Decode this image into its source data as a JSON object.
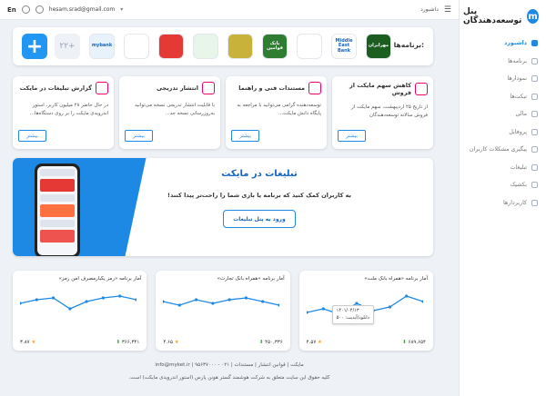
{
  "brand": {
    "title": "پنل توسعه‌دهندگان",
    "logo": "m"
  },
  "topbar": {
    "lang": "En",
    "email": "hesam.srad@gmail.com",
    "breadcrumb": "داشبورد"
  },
  "sidebar": {
    "items": [
      {
        "label": "داشبورد",
        "active": true
      },
      {
        "label": "برنامه‌ها"
      },
      {
        "label": "نمودارها"
      },
      {
        "label": "تیکت‌ها"
      },
      {
        "label": "مالی"
      },
      {
        "label": "پروفایل"
      },
      {
        "label": "پیگیری مشکلات کاربران"
      },
      {
        "label": "تبلیغات"
      },
      {
        "label": "بکشیک"
      },
      {
        "label": "کاربردارها"
      }
    ]
  },
  "apps": {
    "label": "برنامه‌ها:",
    "more": "۲۲+",
    "list": [
      {
        "text": "mybank",
        "color": "#e8f2fb"
      },
      {
        "text": "",
        "color": "#ffffff"
      },
      {
        "text": "",
        "color": "#e53935"
      },
      {
        "text": "",
        "color": "#e8f5e9"
      },
      {
        "text": "",
        "color": "#c8b23a"
      },
      {
        "text": "بانک قوامین",
        "color": "#2e7d32"
      },
      {
        "text": "",
        "color": "#ffffff"
      },
      {
        "text": "Middle East Bank",
        "color": "#ffffff"
      },
      {
        "text": "مهرایران",
        "color": "#1b5e20"
      }
    ]
  },
  "features": [
    {
      "title": "کاهش سهم مایکت از فروش",
      "desc": "از تاریخ ۲۵ اردیبهشت، سهم مایکت از فروش سالانه توسعه‌دهندگان",
      "btn": "بیشتر"
    },
    {
      "title": "مستندات فنی و راهنما",
      "desc": "توسعه‌دهنده گرامی می‌توانید با مراجعه به پایگاه دانش مایکت...",
      "btn": "بیشتر"
    },
    {
      "title": "انتشار تدریجی",
      "desc": "با قابلیت انتشار تدریجی نسخه می‌توانید به‌روزرسانی نسخه جد...",
      "btn": "بیشتر"
    },
    {
      "title": "گزارش تبلیغات در مایکت",
      "desc": "در حال حاضر ۲۸ میلیون کاربر، استور اندرویدی مایکت را بر روی دستگاه‌ها...",
      "btn": "بیشتر"
    }
  ],
  "banner": {
    "title": "تبلیغات در مایکت",
    "subtitle": "به کاربران کمک کنید که برنامه یا بازی شما را راحت‌تر پیدا کنند!",
    "cta": "ورود به پنل تبلیغات"
  },
  "stats": [
    {
      "title": "آمار برنامه «همراه بانک ملت»",
      "downloads": "۶۸۹,۶۵۴",
      "rating": "۴.۵۷",
      "points": [
        22,
        18,
        24,
        12,
        20,
        16,
        4,
        10
      ],
      "tip_date": "۱۴۰۱/۰۴/۱۳",
      "tip_value": "دانلود/آپدیت: ۵۰۰"
    },
    {
      "title": "آمار برنامه «همراه بانک تجارت»",
      "downloads": "۴۵۰,۳۳۶",
      "rating": "۴.۶۵",
      "points": [
        10,
        14,
        8,
        12,
        8,
        6,
        10,
        14
      ]
    },
    {
      "title": "آمار برنامه «رمز یکبارمصرف امن رمز»",
      "downloads": "۳۶۶,۳۴۱",
      "rating": "۳.۸۷",
      "points": [
        12,
        8,
        6,
        18,
        10,
        6,
        4,
        8
      ]
    }
  ],
  "footer": {
    "links": "مایکت | قوانین انتشار | مستندات | ۰۲۱ - ۹۵۶۳۷۰۰۰ | info@myket.ir",
    "copy": "کلیه حقوق این سایت متعلق به شرکت هوشمند گستر هونن پارس (استور اندرویدی مایکت) است."
  }
}
